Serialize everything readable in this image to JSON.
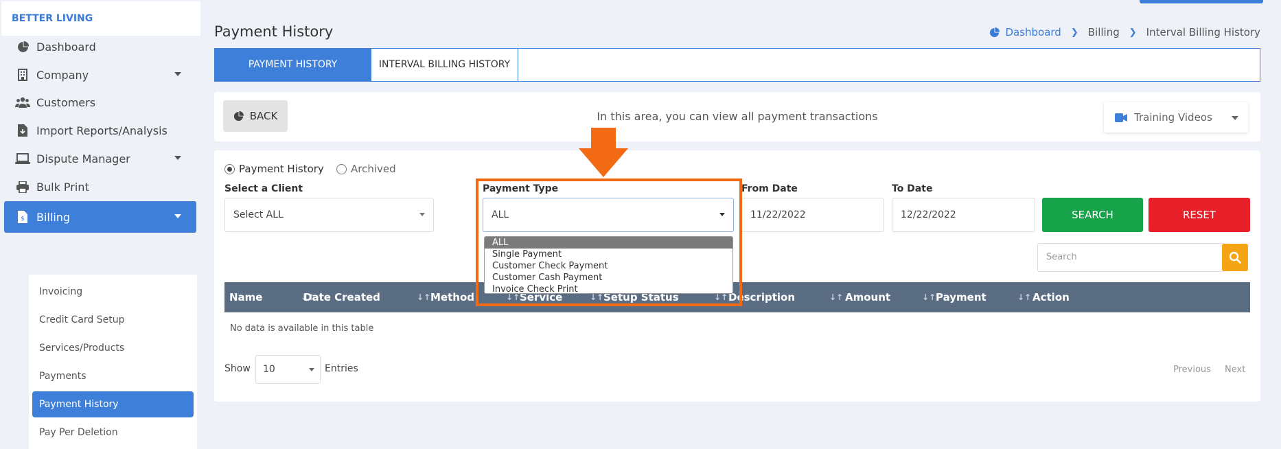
{
  "brand": "BETTER LIVING",
  "sidebar": {
    "items": [
      {
        "label": "Dashboard",
        "icon": "dashboard-icon"
      },
      {
        "label": "Company",
        "icon": "building-icon"
      },
      {
        "label": "Customers",
        "icon": "users-icon"
      },
      {
        "label": "Import Reports/Analysis",
        "icon": "import-file-icon"
      },
      {
        "label": "Dispute Manager",
        "icon": "laptop-icon"
      },
      {
        "label": "Bulk Print",
        "icon": "printer-icon"
      },
      {
        "label": "Billing",
        "icon": "billing-file-icon"
      }
    ],
    "billing_submenu": [
      "Invoicing",
      "Credit Card Setup",
      "Services/Products",
      "Payments",
      "Payment History",
      "Pay Per Deletion"
    ]
  },
  "header": {
    "title": "Payment History",
    "breadcrumb": [
      "Dashboard",
      "Billing",
      "Interval Billing History"
    ]
  },
  "tabs": [
    "PAYMENT HISTORY",
    "INTERVAL BILLING HISTORY"
  ],
  "toolbar": {
    "back_label": "BACK",
    "info": "In this area, you can view all payment transactions",
    "training_label": "Training Videos"
  },
  "filters": {
    "radio_payment_history": "Payment History",
    "radio_archived": "Archived",
    "client_label": "Select a Client",
    "client_value": "Select ALL",
    "payment_type_label": "Payment Type",
    "payment_type_value": "ALL",
    "from_label": "From Date",
    "from_value": "11/22/2022",
    "to_label": "To Date",
    "to_value": "12/22/2022",
    "search_label": "SEARCH",
    "reset_label": "RESET",
    "search_placeholder": "Search"
  },
  "payment_type_options": [
    "ALL",
    "Single Payment",
    "Customer Check Payment",
    "Customer Cash Payment",
    "Invoice Check Print"
  ],
  "table": {
    "columns": [
      "Name",
      "Date Created",
      "Method",
      "Service",
      "Setup Status",
      "Description",
      "Amount",
      "Payment",
      "Action"
    ],
    "empty_text": "No data is available in this table"
  },
  "footer": {
    "show_label": "Show",
    "page_size": "10",
    "entries_label": "Entries",
    "prev_label": "Previous",
    "next_label": "Next"
  },
  "colors": {
    "primary": "#3d7fd9",
    "success": "#16a34a",
    "danger": "#e8202a",
    "warning": "#f4a414",
    "highlight": "#f26b14",
    "table_header": "#5b6d83"
  }
}
